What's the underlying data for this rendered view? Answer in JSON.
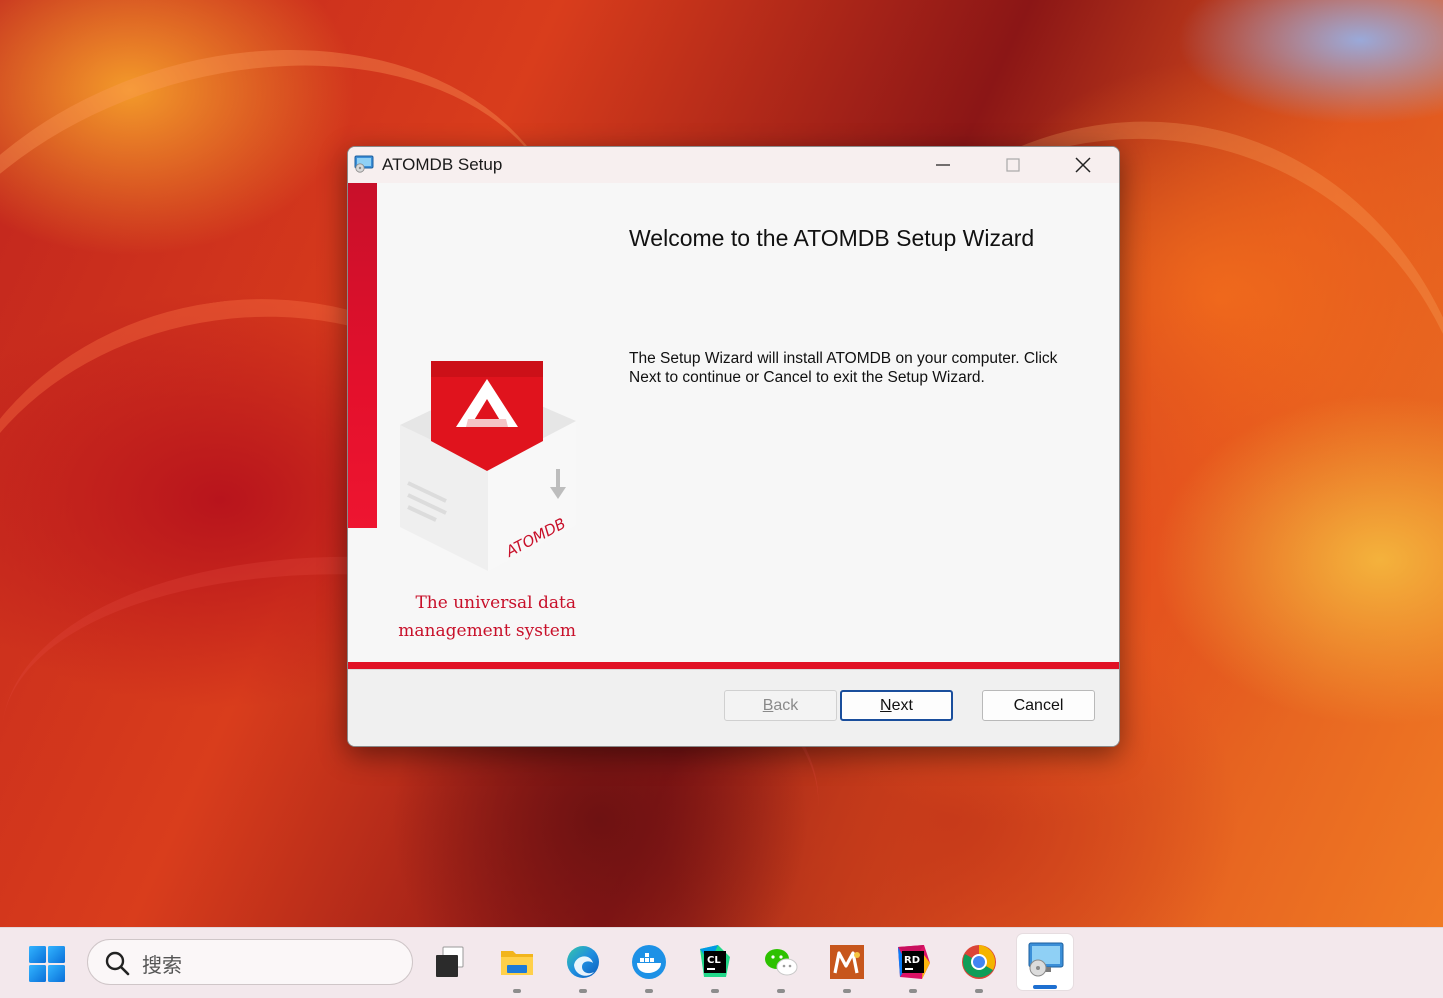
{
  "window": {
    "title": "ATOMDB Setup",
    "controls": [
      "minimize",
      "maximize",
      "close"
    ]
  },
  "wizard": {
    "heading": "Welcome to the ATOMDB Setup Wizard",
    "body_lines": [
      "The Setup Wizard will install ATOMDB on your computer. Click",
      "Next to continue or Cancel to exit the Setup Wizard."
    ],
    "logo_text": "ATOMDB",
    "tagline_lines": [
      "The universal data",
      "management system"
    ]
  },
  "buttons": {
    "back": {
      "prefix": "",
      "accel": "B",
      "rest": "ack",
      "enabled": false
    },
    "next": {
      "prefix": "",
      "accel": "N",
      "rest": "ext",
      "enabled": true
    },
    "cancel": {
      "label": "Cancel",
      "enabled": true
    }
  },
  "taskbar": {
    "search_placeholder": "搜索",
    "apps": [
      {
        "name": "task-view"
      },
      {
        "name": "file-explorer"
      },
      {
        "name": "edge"
      },
      {
        "name": "docker"
      },
      {
        "name": "clion",
        "label": "CL"
      },
      {
        "name": "wechat"
      },
      {
        "name": "mathematica"
      },
      {
        "name": "rider",
        "label": "RD"
      },
      {
        "name": "chrome"
      },
      {
        "name": "setup-installer",
        "active": true
      }
    ]
  },
  "colors": {
    "accent_red": "#e11225",
    "brand_red": "#c8102a",
    "focus_blue": "#1a4e9c"
  }
}
